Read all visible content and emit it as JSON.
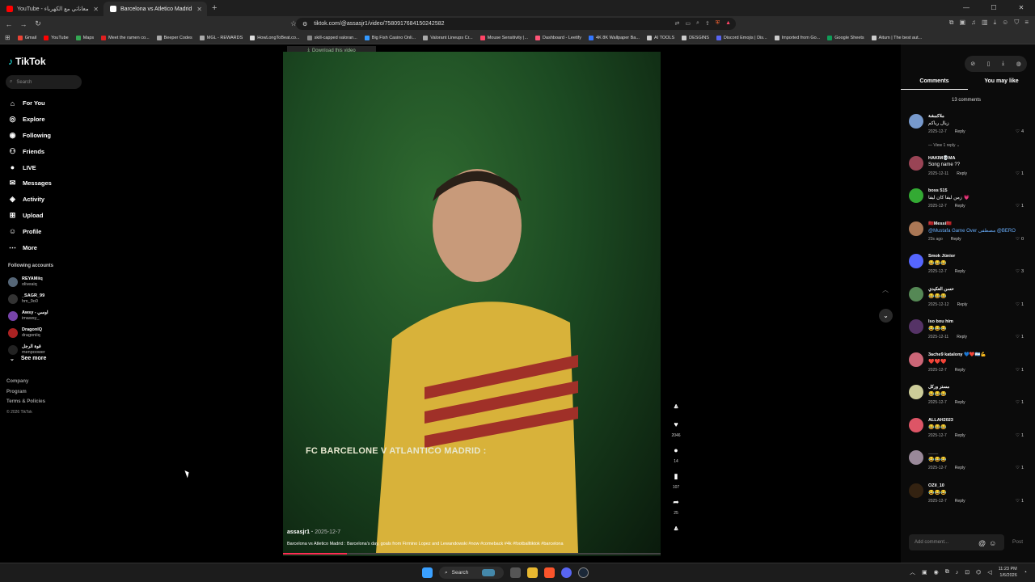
{
  "browser": {
    "tabs": [
      {
        "label": "YouTube - معاناتي مع الكهرباء",
        "color": "#ff0000"
      },
      {
        "label": "Barcelona vs Atletico Madrid",
        "color": "#ffffff"
      }
    ],
    "url": "tiktok.com/@assasjr1/video/7580917684150242582",
    "bookmarks": [
      {
        "label": "Gmail",
        "color": "#ea4335"
      },
      {
        "label": "YouTube",
        "color": "#ff0000"
      },
      {
        "label": "Maps",
        "color": "#34a853"
      },
      {
        "label": "Meet the ramen co...",
        "color": "#e02020"
      },
      {
        "label": "Beeper Codes",
        "color": "#aaaaaa"
      },
      {
        "label": "MGL - REWARDS",
        "color": "#aaaaaa"
      },
      {
        "label": "HowLongToBeat.co...",
        "color": "#dddddd"
      },
      {
        "label": "skill-capped valoran...",
        "color": "#888888"
      },
      {
        "label": "Big Fish Casino Onli...",
        "color": "#3399ff"
      },
      {
        "label": "Valorant Lineups Cr...",
        "color": "#aaaaaa"
      },
      {
        "label": "Mouse Sensitivity |...",
        "color": "#ff4466"
      },
      {
        "label": "Dashboard - Leetify",
        "color": "#ff5577"
      },
      {
        "label": "4K 8K Wallpaper Ba...",
        "color": "#3377ff"
      },
      {
        "label": "AI TOOLS",
        "color": "#cccccc"
      },
      {
        "label": "DESGINS",
        "color": "#cccccc"
      },
      {
        "label": "Discord Emojis | Dis...",
        "color": "#5865f2"
      },
      {
        "label": "Imported from Go...",
        "color": "#cccccc"
      },
      {
        "label": "Google Sheets",
        "color": "#0f9d58"
      },
      {
        "label": "Aitum | The best aut...",
        "color": "#cccccc"
      }
    ]
  },
  "tiktok": {
    "logo": "TikTok",
    "search_placeholder": "Search",
    "nav": [
      {
        "label": "For You",
        "icon": "⌂"
      },
      {
        "label": "Explore",
        "icon": "◎"
      },
      {
        "label": "Following",
        "icon": "◉"
      },
      {
        "label": "Friends",
        "icon": "⚇"
      },
      {
        "label": "LIVE",
        "icon": "●"
      },
      {
        "label": "Messages",
        "icon": "✉"
      },
      {
        "label": "Activity",
        "icon": "◈"
      },
      {
        "label": "Upload",
        "icon": "⊞"
      },
      {
        "label": "Profile",
        "icon": "☺"
      },
      {
        "label": "More",
        "icon": "⋯"
      }
    ],
    "following_title": "Following accounts",
    "accounts": [
      {
        "name": "REYAMiiq",
        "handle": "oliveaiq",
        "color": "#556677"
      },
      {
        "name": "_SAGR_99",
        "handle": "hm_9o0",
        "color": "#333333"
      },
      {
        "name": "Awsy - اوسي",
        "handle": "imawsy_",
        "color": "#7744aa"
      },
      {
        "name": "DragonIQ",
        "handle": "dragoniiq",
        "color": "#aa2222"
      },
      {
        "name": "قوة الرجل",
        "handle": "menpoower",
        "color": "#222222"
      }
    ],
    "see_more": "See more",
    "footer": {
      "company": "Company",
      "program": "Program",
      "terms": "Terms & Policies",
      "copyright": "© 2026 TikTok"
    }
  },
  "video": {
    "download_banner": "Download this video",
    "overlay_text": "FC BARCELONE V ATLANTICO MADRID :",
    "author": "assasjr1",
    "date": "2025-12-7",
    "caption": "Barcelona vs Atletico Madrid : Barcelona's day, goals from Firmino Lopez and Lewandowski #now #comeback #4k #footballtiktok #barcelona",
    "progress": 0.17,
    "likes": "2046",
    "comments": "14",
    "saves": "107",
    "shares": "25"
  },
  "panel": {
    "tab_comments": "Comments",
    "tab_you_may_like": "You may like",
    "comment_count": "13 comments",
    "view_replies": "View 1 reply",
    "add_comment_placeholder": "Add comment...",
    "post": "Post",
    "reply_label": "Reply",
    "comments": [
      {
        "user": "ملاكمشة",
        "text": "زيال رياكم",
        "date": "2025-12-7",
        "likes": "4",
        "color": "#7799cc",
        "link": false
      },
      {
        "user": "HAKIM💀MA",
        "text": "Song name ??",
        "date": "2025-12-11",
        "likes": "1",
        "color": "#994455",
        "link": false
      },
      {
        "user": "boss 515",
        "text": "زمن ليفا كان ليفا 💗",
        "date": "2025-12-7",
        "likes": "1",
        "color": "#33aa33",
        "link": false
      },
      {
        "user": "🇲🇦Messi🇲🇦",
        "text": "@Mustafa Game Over مصطفى @BERO",
        "date": "23s ago",
        "likes": "0",
        "color": "#aa7755",
        "link": true
      },
      {
        "user": "Smok Jünior",
        "text": "😂😂😂",
        "date": "2025-12-7",
        "likes": "3",
        "color": "#5566ff",
        "link": false
      },
      {
        "user": "حسن العكيدي",
        "text": "😂😂😂",
        "date": "2025-12-12",
        "likes": "1",
        "color": "#558855",
        "link": false
      },
      {
        "user": "lso bou him",
        "text": "😂😂😂",
        "date": "2025-12-11",
        "likes": "1",
        "color": "#553366",
        "link": false
      },
      {
        "user": "3ache9 katalony 💙❤️🇦🇷💪",
        "text": "❤️❤️❤️",
        "date": "2025-12-7",
        "likes": "1",
        "color": "#cc6677",
        "link": false
      },
      {
        "user": "مستر وركل",
        "text": "😂😂😂",
        "date": "2025-12-7",
        "likes": "1",
        "color": "#cccc99",
        "link": false
      },
      {
        "user": "ALLAH2023",
        "text": "😂😂😂",
        "date": "2025-12-7",
        "likes": "1",
        "color": "#dd5566",
        "link": false
      },
      {
        "user": "____",
        "text": "😂😂😂",
        "date": "2025-12-7",
        "likes": "1",
        "color": "#998899",
        "link": false
      },
      {
        "user": "OZil_10",
        "text": "😂😂😂",
        "date": "2025-12-7",
        "likes": "1",
        "color": "#332211",
        "link": false
      }
    ]
  },
  "taskbar": {
    "search": "Search",
    "time": "11:23 PM",
    "date": "1/6/2026"
  }
}
